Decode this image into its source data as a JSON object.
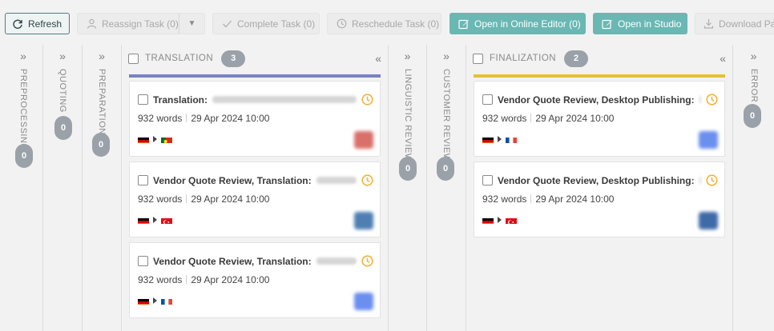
{
  "toolbar": {
    "refresh": "Refresh",
    "reassign": "Reassign Task (0)",
    "complete": "Complete Task (0)",
    "reschedule": "Reschedule Task (0)",
    "open_online_editor": "Open in Online Editor (0)",
    "open_studio": "Open in Studio",
    "download": "Download Pac"
  },
  "columns": {
    "preprocessing": {
      "label": "PREPROCESSING",
      "count": "0"
    },
    "quoting": {
      "label": "QUOTING",
      "count": "0"
    },
    "preparation": {
      "label": "PREPARATION",
      "count": "0"
    },
    "translation": {
      "label": "TRANSLATION",
      "count": "3",
      "bar_color": "#7b80c4"
    },
    "linguistic_review": {
      "label": "LINGUISTIC REVIEW",
      "count": "0"
    },
    "customer_review": {
      "label": "CUSTOMER REVIEW",
      "count": "0"
    },
    "finalization": {
      "label": "FINALIZATION",
      "count": "2",
      "bar_color": "#e6c235"
    },
    "error": {
      "label": "ERROR",
      "count": "0"
    }
  },
  "translation_cards": [
    {
      "title": "Translation:",
      "words": "932 words",
      "date": "29 Apr 2024 10:00",
      "from_flag": "de",
      "to_flag": "pt",
      "avatar_color": "#d9706a"
    },
    {
      "title": "Vendor Quote Review, Translation:",
      "words": "932 words",
      "date": "29 Apr 2024 10:00",
      "from_flag": "de",
      "to_flag": "tr",
      "avatar_color": "#4f7fb2"
    },
    {
      "title": "Vendor Quote Review, Translation:",
      "words": "932 words",
      "date": "29 Apr 2024 10:00",
      "from_flag": "de",
      "to_flag": "fr",
      "avatar_color": "#6b8fef"
    }
  ],
  "finalization_cards": [
    {
      "title": "Vendor Quote Review, Desktop Publishing:",
      "words": "932 words",
      "date": "29 Apr 2024 10:00",
      "from_flag": "de",
      "to_flag": "fr",
      "avatar_color": "#6b8fef"
    },
    {
      "title": "Vendor Quote Review, Desktop Publishing:",
      "words": "932 words",
      "date": "29 Apr 2024 10:00",
      "from_flag": "de",
      "to_flag": "tr",
      "avatar_color": "#3f6aa8"
    }
  ],
  "colors": {
    "clock": "#f0b43c",
    "teal_button": "#6ab7b3"
  }
}
